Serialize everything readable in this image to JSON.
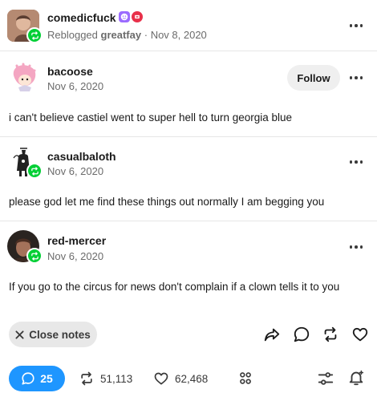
{
  "post_header": {
    "username": "comedicfuck",
    "reblogged_prefix": "Reblogged",
    "reblogged_from": "greatfay",
    "separator": "·",
    "date": "Nov 8, 2020",
    "badge_icons": [
      "purple-face-badge-icon",
      "red-badge-icon"
    ]
  },
  "thread": [
    {
      "username": "bacoose",
      "date": "Nov 6, 2020",
      "follow_label": "Follow",
      "text": "i can't believe castiel went to super hell to turn georgia blue"
    },
    {
      "username": "casualbaloth",
      "date": "Nov 6, 2020",
      "text": "please god let me find these things out normally I am begging you"
    },
    {
      "username": "red-mercer",
      "date": "Nov 6, 2020",
      "text": "If you go to the circus for news don't complain if a clown tells it to you"
    }
  ],
  "actions": {
    "close_notes_label": "Close notes",
    "icons": [
      "share-icon",
      "reply-icon",
      "reblog-icon",
      "like-icon"
    ]
  },
  "footer": {
    "comments_count": "25",
    "reblogs_count": "51,113",
    "likes_count": "62,468",
    "icons": [
      "comment-icon",
      "reblog-icon",
      "heart-icon",
      "community-icon",
      "filter-icon",
      "notification-bell-icon"
    ]
  },
  "colors": {
    "accent_blue": "#1e96ff",
    "reblog_green": "#00cf35",
    "text": "#1a1a1a",
    "muted": "#6b6b6b"
  }
}
